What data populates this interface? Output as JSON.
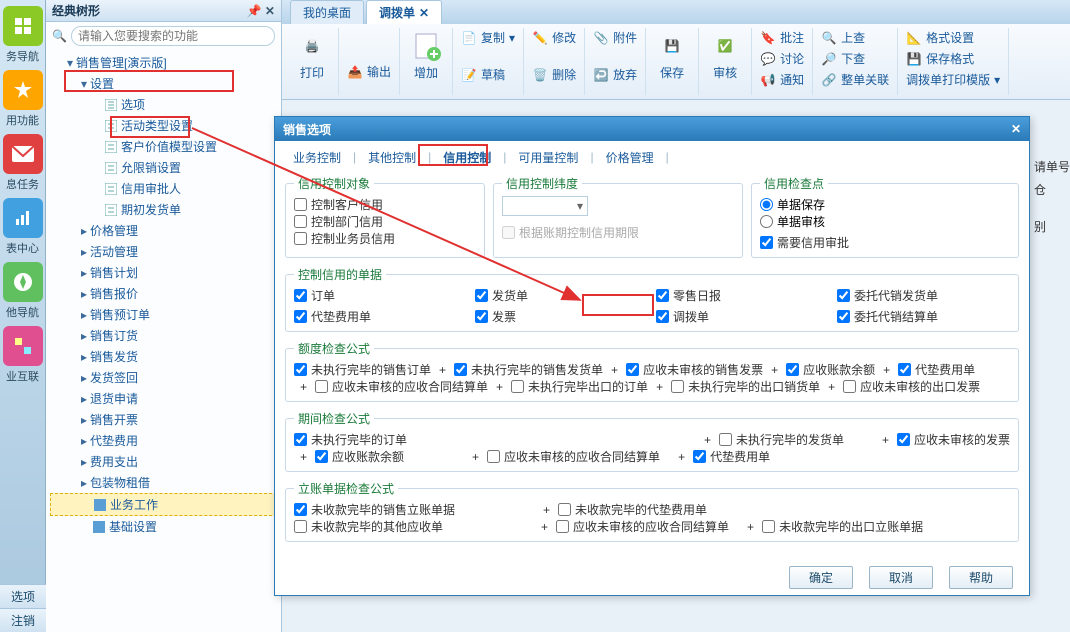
{
  "tree": {
    "title": "经典树形",
    "search_placeholder": "请输入您要搜索的功能",
    "root": "销售管理[演示版]",
    "settings": "设置",
    "options": "选项",
    "nodes_settings_children": [
      "活动类型设置",
      "客户价值模型设置",
      "允限销设置",
      "信用审批人",
      "期初发货单"
    ],
    "nodes_modules": [
      "价格管理",
      "活动管理",
      "销售计划",
      "销售报价",
      "销售预订单",
      "销售订货",
      "销售发货",
      "发货签回",
      "退货申请",
      "销售开票",
      "代垫费用",
      "费用支出",
      "包装物租借"
    ],
    "biz_work": "业务工作",
    "basic_settings": "基础设置"
  },
  "side_icons": [
    "务导航",
    "用功能",
    "息任务",
    "表中心",
    "他导航",
    "业互联"
  ],
  "bottom_tabs": [
    "选项",
    "注销"
  ],
  "main_tabs": {
    "desktop": "我的桌面",
    "bill": "调拨单"
  },
  "ribbon": {
    "print": "打印",
    "output": "输出",
    "add": "增加",
    "copy": "复制",
    "draft": "草稿",
    "modify": "修改",
    "delete": "删除",
    "attach": "附件",
    "release": "放弃",
    "save": "保存",
    "audit": "审核",
    "batch_approve": "批注",
    "discuss": "讨论",
    "notify": "通知",
    "up": "上查",
    "down": "下查",
    "order_rel": "整单关联",
    "format": "格式设置",
    "save_format": "保存格式",
    "tpl": "调拨单打印模版"
  },
  "dialog": {
    "title": "销售选项",
    "tabs": [
      "业务控制",
      "其他控制",
      "信用控制",
      "可用量控制",
      "价格管理"
    ],
    "group_obj": {
      "legend": "信用控制对象",
      "items": [
        "控制客户信用",
        "控制部门信用",
        "控制业务员信用"
      ]
    },
    "group_dim": {
      "legend": "信用控制纬度",
      "hint": "根据账期控制信用期限"
    },
    "group_check": {
      "legend": "信用检查点",
      "r1": "单据保存",
      "r2": "单据审核",
      "c1": "需要信用审批"
    },
    "group_bills": {
      "legend": "控制信用的单据",
      "row1": [
        "订单",
        "发货单",
        "零售日报",
        "委托代销发货单"
      ],
      "row2": [
        "代垫费用单",
        "发票",
        "调拨单",
        "委托代销结算单"
      ]
    },
    "group_quota": {
      "legend": "额度检查公式",
      "row1": [
        "未执行完毕的销售订单",
        "未执行完毕的销售发货单",
        "应收未审核的销售发票",
        "应收账款余额",
        "代垫费用单"
      ],
      "row2": [
        "应收未审核的应收合同结算单",
        "未执行完毕出口的订单",
        "未执行完毕的出口销货单",
        "应收未审核的出口发票"
      ]
    },
    "group_period": {
      "legend": "期间检查公式",
      "row1": [
        "未执行完毕的订单",
        "未执行完毕的发货单",
        "应收未审核的发票"
      ],
      "row2": [
        "应收账款余额",
        "应收未审核的应收合同结算单",
        "代垫费用单"
      ]
    },
    "group_ledger": {
      "legend": "立账单据检查公式",
      "row1": [
        "未收款完毕的销售立账单据",
        "未收款完毕的代垫费用单"
      ],
      "row2": [
        "未收款完毕的其他应收单",
        "应收未审核的应收合同结算单",
        "未收款完毕的出口立账单据"
      ]
    },
    "buttons": {
      "ok": "确定",
      "cancel": "取消",
      "help": "帮助"
    }
  },
  "right_cut": {
    "a": "请单号",
    "b": "仓",
    "c": "别"
  }
}
